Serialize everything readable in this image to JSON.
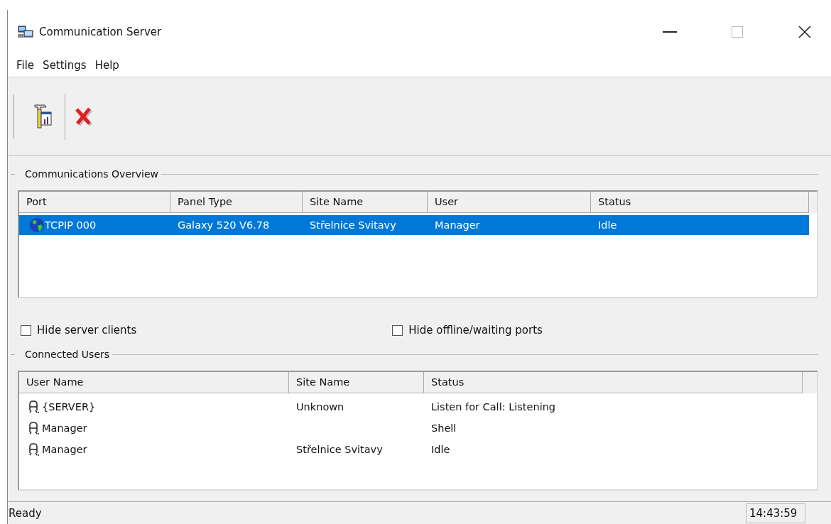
{
  "window": {
    "title": "Communication Server",
    "caption_buttons": [
      {
        "kind": "minimize",
        "disabled": false
      },
      {
        "kind": "maximize",
        "disabled": true
      },
      {
        "kind": "close",
        "disabled": false
      }
    ]
  },
  "menu": [
    "File",
    "Settings",
    "Help"
  ],
  "toolbar": [
    {
      "kind": "tools"
    },
    {
      "kind": "delete"
    }
  ],
  "overview": {
    "title": "Communications Overview",
    "columns": [
      "Port",
      "Panel Type",
      "Site Name",
      "User",
      "Status"
    ],
    "rows": [
      {
        "cells": [
          "TCPIP 000",
          "Galaxy 520 V6.78",
          "Střelnice Svitavy",
          "Manager",
          "Idle"
        ],
        "selected": true
      }
    ]
  },
  "options": [
    {
      "label": "Hide server clients",
      "checked": false
    },
    {
      "label": "Hide offline/waiting ports",
      "checked": false
    }
  ],
  "users": {
    "title": "Connected Users",
    "columns": [
      "User Name",
      "Site Name",
      "Status"
    ],
    "rows": [
      {
        "cells": [
          "{SERVER}",
          "Unknown",
          "Listen for Call: Listening"
        ]
      },
      {
        "cells": [
          "Manager",
          "",
          "Shell"
        ]
      },
      {
        "cells": [
          "Manager",
          "Střelnice Svitavy",
          "Idle"
        ]
      }
    ]
  },
  "status_bar": {
    "message": "Ready",
    "time": "14:43:59"
  }
}
